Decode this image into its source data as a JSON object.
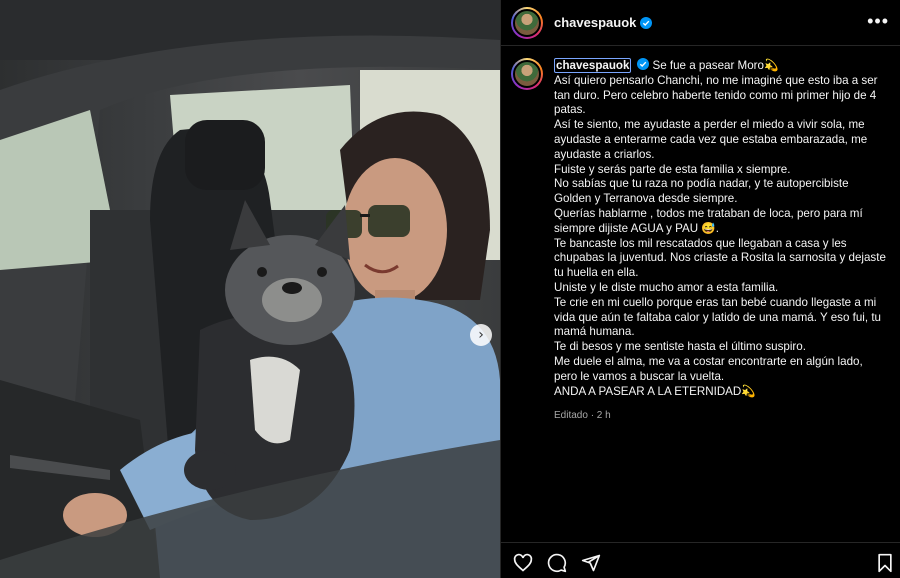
{
  "post": {
    "username": "chavespauok",
    "verified": true,
    "more_label": "•••"
  },
  "caption": {
    "username": "chavespauok",
    "text": "Se fue a pasear Moro💫\nAsí quiero pensarlo Chanchi, no me imaginé que esto iba a ser tan duro. Pero celebro haberte tenido como mi primer hijo de 4 patas.\nAsí te siento, me ayudaste a perder el miedo a vivir sola, me ayudaste a enterarme cada vez que estaba embarazada, me ayudaste a criarlos.\nFuiste y serás parte de esta familia x siempre.\nNo sabías que tu raza no podía nadar, y te autopercibiste Golden y Terranova desde siempre.\nQuerías hablarme , todos me trataban de loca, pero para mí siempre dijiste AGUA y PAU 😅.\nTe bancaste los mil rescatados que llegaban a casa y les chupabas la juventud. Nos criaste a Rosita la sarnosita y dejaste tu huella en ella.\nUniste y le diste mucho amor a esta familia.\nTe crie en mi cuello porque eras tan bebé cuando llegaste a mi vida que aún te faltaba calor y latido de una mamá. Y eso fui, tu mamá humana.\nTe di besos y me sentiste hasta el último suspiro.\nMe duele el alma, me va a costar encontrarte en algún lado, pero le vamos a buscar la vuelta.\nANDA A PASEAR A LA ETERNIDAD💫",
    "meta": "Editado · 2 h"
  },
  "carousel": {
    "next_glyph": "›"
  },
  "icons": {
    "like": "heart-icon",
    "comment": "comment-icon",
    "share": "share-icon",
    "save": "bookmark-icon",
    "verified": "verified-badge-icon"
  },
  "colors": {
    "verified": "#0095f6",
    "background": "#000000",
    "divider": "#262626",
    "meta": "#a8a8a8"
  }
}
